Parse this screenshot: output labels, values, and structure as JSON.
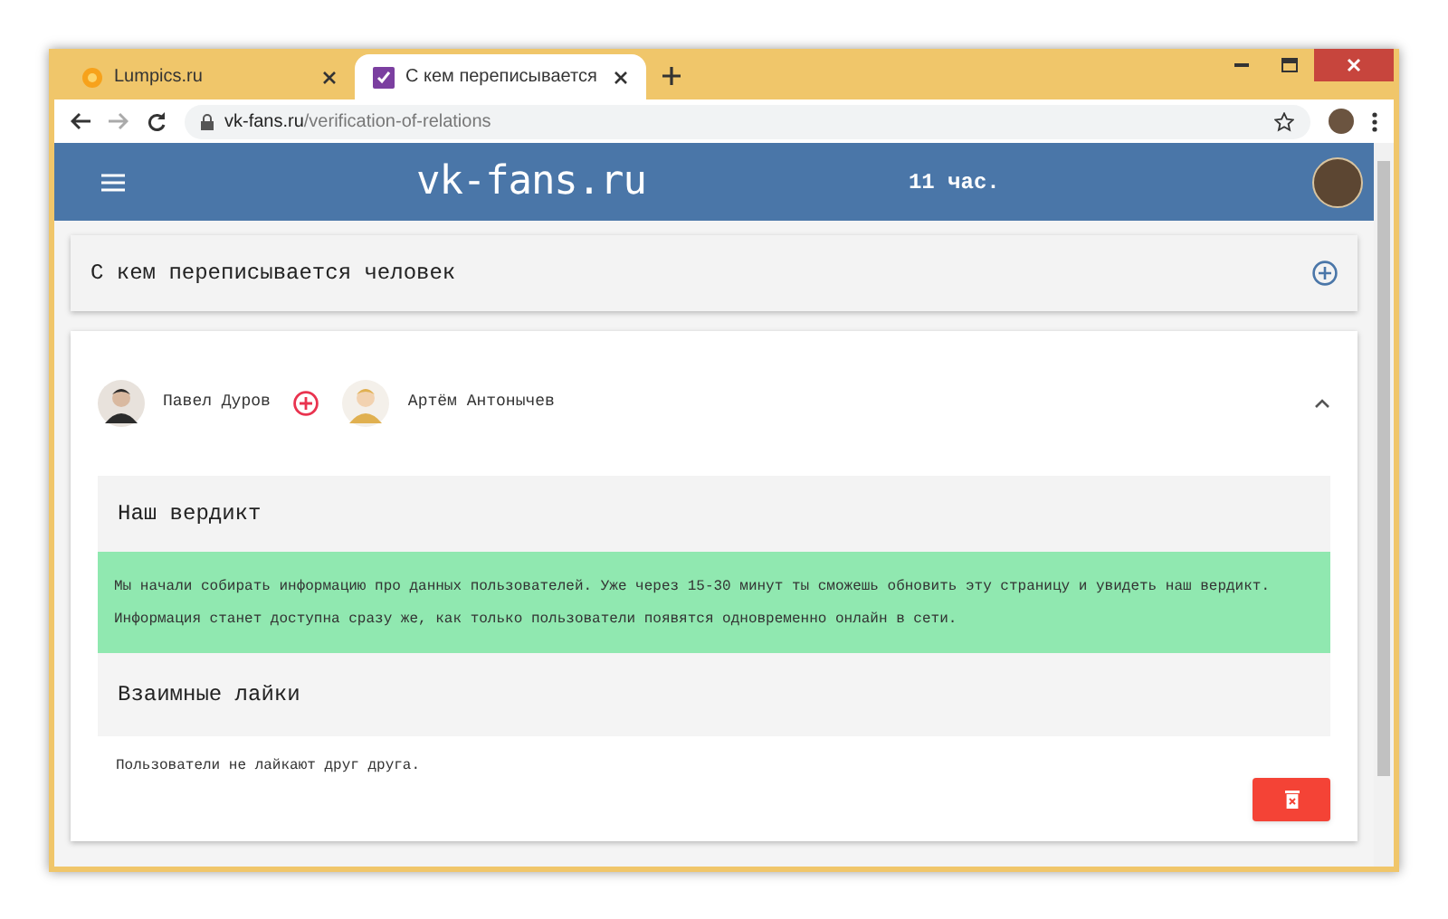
{
  "browser": {
    "tabs": [
      {
        "label": "Lumpics.ru",
        "selected": false
      },
      {
        "label": "С кем переписывается",
        "selected": true
      }
    ],
    "address": {
      "domain": "vk-fans.ru",
      "path": "/verification-of-relations"
    }
  },
  "header": {
    "logo": "vk-fans.ru",
    "time": "11 час."
  },
  "search_card": {
    "title": "С кем переписывается человек"
  },
  "result_card": {
    "expanded": true,
    "users": [
      {
        "name": "Павел Дуров"
      },
      {
        "name": "Артём Антонычев"
      }
    ],
    "verdict": {
      "title": "Наш вердикт",
      "lines": [
        "Мы начали собирать информацию про данных пользователей. Уже через 15-30 минут ты сможешь обновить эту страницу и увидеть наш вердикт.",
        "Информация станет доступна сразу же, как только пользователи появятся одновременно онлайн в сети."
      ]
    },
    "likes": {
      "title": "Взаимные лайки",
      "text": "Пользователи не лайкают друг друга."
    }
  }
}
